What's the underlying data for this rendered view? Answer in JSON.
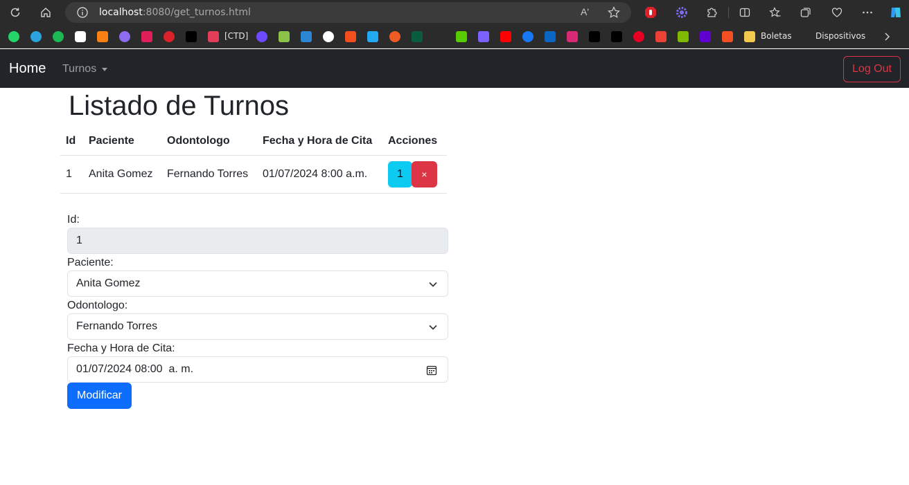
{
  "browser": {
    "url_host": "localhost",
    "url_rest": ":8080/get_turnos.html",
    "read_aloud": "Aʹ"
  },
  "bookmarks": {
    "ctd": "[CTD]",
    "boletas": "Boletas",
    "dispositivos": "Dispositivos"
  },
  "navbar": {
    "brand": "Home",
    "dropdown": "Turnos",
    "logout": "Log Out"
  },
  "page": {
    "title": "Listado de Turnos"
  },
  "table": {
    "headers": [
      "Id",
      "Paciente",
      "Odontologo",
      "Fecha y Hora de Cita",
      "Acciones"
    ],
    "rows": [
      {
        "id": "1",
        "paciente": "Anita Gomez",
        "odontologo": "Fernando Torres",
        "fecha": "01/07/2024 8:00 a.m.",
        "edit_label": "1",
        "delete_label": "×"
      }
    ]
  },
  "form": {
    "id_label": "Id:",
    "id_value": "1",
    "paciente_label": "Paciente:",
    "paciente_value": "Anita Gomez",
    "odontologo_label": "Odontologo:",
    "odontologo_value": "Fernando Torres",
    "fecha_label": "Fecha y Hora de Cita:",
    "fecha_value": "01/07/2024 08:00  a. m.",
    "submit": "Modificar"
  },
  "colors": {
    "navbar_bg": "#212529",
    "primary": "#0d6efd",
    "info": "#0dcaf0",
    "danger": "#dc3545"
  }
}
